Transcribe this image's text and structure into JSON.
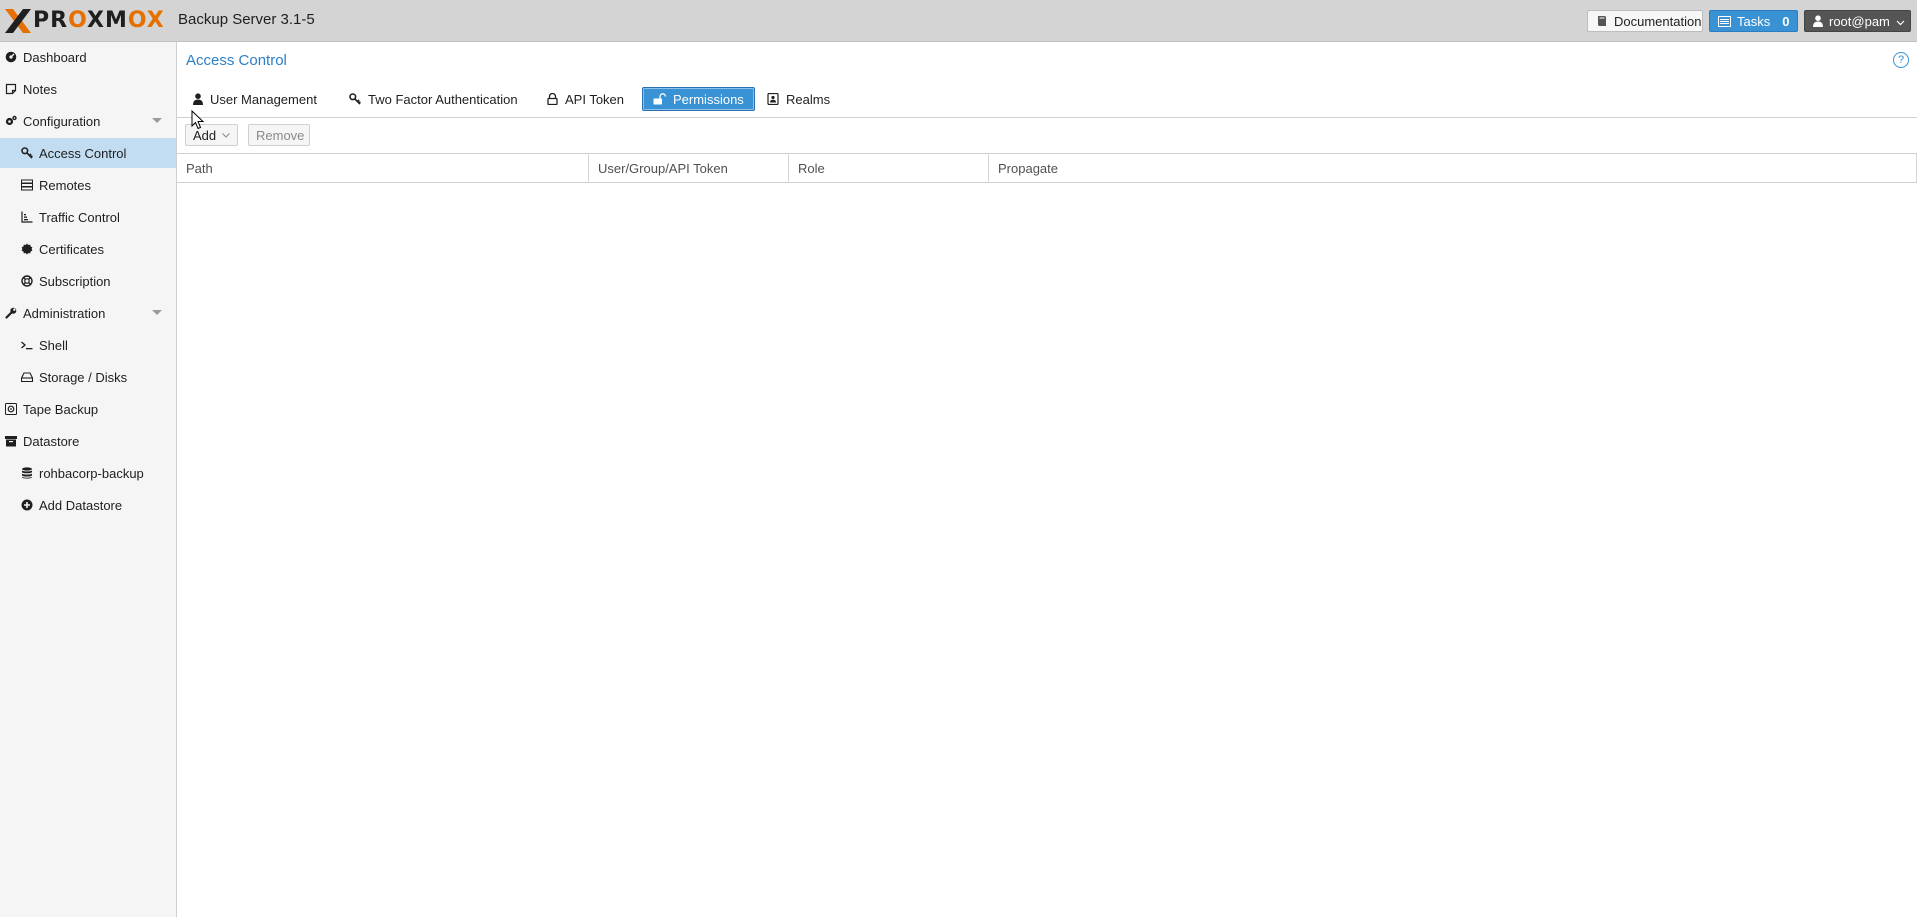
{
  "topbar": {
    "logo": {
      "text_prefix": "PR",
      "text_o": "O",
      "text_xm": "XM",
      "text_o2": "O",
      "text_x": "X"
    },
    "product": "Backup Server 3.1-5",
    "documentation": "Documentation",
    "tasks_label": "Tasks",
    "tasks_count": "0",
    "user": "root@pam"
  },
  "sidebar": {
    "items": [
      {
        "label": "Dashboard",
        "icon": "dashboard-icon",
        "level": 0
      },
      {
        "label": "Notes",
        "icon": "note-icon",
        "level": 0
      },
      {
        "label": "Configuration",
        "icon": "gears-icon",
        "level": 0,
        "expanded": true
      },
      {
        "label": "Access Control",
        "icon": "key-icon",
        "level": 1,
        "active": true
      },
      {
        "label": "Remotes",
        "icon": "server-icon",
        "level": 1
      },
      {
        "label": "Traffic Control",
        "icon": "chart-icon",
        "level": 1
      },
      {
        "label": "Certificates",
        "icon": "certificate-icon",
        "level": 1
      },
      {
        "label": "Subscription",
        "icon": "support-icon",
        "level": 1
      },
      {
        "label": "Administration",
        "icon": "wrench-icon",
        "level": 0,
        "expanded": true
      },
      {
        "label": "Shell",
        "icon": "terminal-icon",
        "level": 1
      },
      {
        "label": "Storage / Disks",
        "icon": "hdd-icon",
        "level": 1
      },
      {
        "label": "Tape Backup",
        "icon": "tape-icon",
        "level": 0
      },
      {
        "label": "Datastore",
        "icon": "archive-icon",
        "level": 0
      },
      {
        "label": "rohbacorp-backup",
        "icon": "database-icon",
        "level": 1
      },
      {
        "label": "Add Datastore",
        "icon": "plus-circle-icon",
        "level": 1
      }
    ]
  },
  "main": {
    "title": "Access Control",
    "tabs": [
      {
        "label": "User Management",
        "icon": "user-icon"
      },
      {
        "label": "Two Factor Authentication",
        "icon": "key-icon"
      },
      {
        "label": "API Token",
        "icon": "lock-icon"
      },
      {
        "label": "Permissions",
        "icon": "unlock-icon",
        "active": true
      },
      {
        "label": "Realms",
        "icon": "address-book-icon"
      }
    ],
    "toolbar": {
      "add": "Add",
      "remove": "Remove"
    },
    "columns": [
      "Path",
      "User/Group/API Token",
      "Role",
      "Propagate"
    ]
  },
  "colors": {
    "accent": "#3892d4",
    "logo_orange": "#e57000",
    "active_nav": "#c2ddf2"
  }
}
